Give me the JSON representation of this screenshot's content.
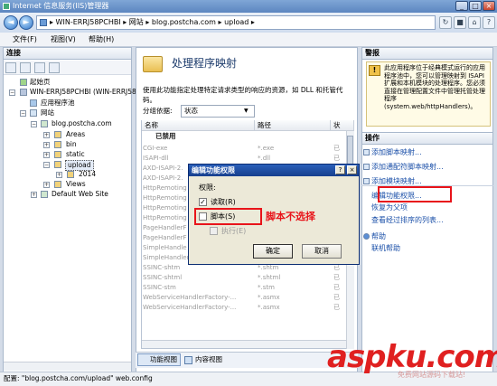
{
  "window": {
    "title": "Internet 信息服务(IIS)管理器"
  },
  "address": {
    "path": "▸ WIN-ERRJ58PCHBI ▸ 网站 ▸ blog.postcha.com ▸ upload ▸"
  },
  "menu": {
    "items": [
      "文件(F)",
      "视图(V)",
      "帮助(H)"
    ]
  },
  "connections": {
    "title": "连接",
    "tree": [
      {
        "label": "起始页",
        "level": 1
      },
      {
        "label": "WIN-ERRJ58PCHBI (WIN-ERRJ58",
        "level": 1
      },
      {
        "label": "应用程序池",
        "level": 2
      },
      {
        "label": "网站",
        "level": 2
      },
      {
        "label": "blog.postcha.com",
        "level": 3
      },
      {
        "label": "Areas",
        "level": 4
      },
      {
        "label": "bin",
        "level": 4
      },
      {
        "label": "static",
        "level": 4
      },
      {
        "label": "upload",
        "level": 4
      },
      {
        "label": "2014",
        "level": 5
      },
      {
        "label": "Views",
        "level": 4
      },
      {
        "label": "Default Web Site",
        "level": 3
      }
    ]
  },
  "main": {
    "title": "处理程序映射",
    "description": "使用此功能指定处理特定请求类型的响应的资源，如 DLL 和托管代码。",
    "group_by_label": "分组依据:",
    "group_by_value": "状态",
    "columns": [
      "名称",
      "路径",
      "状"
    ],
    "group_header": "已禁用",
    "rows": [
      {
        "name": "CGI-exe",
        "path": "*.exe",
        "state": "已"
      },
      {
        "name": "ISAPI-dll",
        "path": "*.dll",
        "state": "已"
      },
      {
        "name": "AXD-ISAPI-2.",
        "path": "*.axd",
        "state": "已"
      },
      {
        "name": "AXD-ISAPI-2.",
        "path": "*.axd",
        "state": "已"
      },
      {
        "name": "HttpRemoting",
        "path": "*.rem",
        "state": "已"
      },
      {
        "name": "HttpRemoting",
        "path": "*.rem",
        "state": "已"
      },
      {
        "name": "HttpRemoting",
        "path": "*.soap",
        "state": "已"
      },
      {
        "name": "HttpRemoting",
        "path": "*.soap",
        "state": "已"
      },
      {
        "name": "PageHandlerF",
        "path": "*.aspx",
        "state": "已"
      },
      {
        "name": "PageHandlerF",
        "path": "*.aspx",
        "state": "已"
      },
      {
        "name": "SimpleHandle",
        "path": "*.ashx",
        "state": "已"
      },
      {
        "name": "SimpleHandlerFactory-ISAP...",
        "path": "*.ashx",
        "state": "已"
      },
      {
        "name": "SSINC-shtm",
        "path": "*.shtm",
        "state": "已"
      },
      {
        "name": "SSINC-shtml",
        "path": "*.shtml",
        "state": "已"
      },
      {
        "name": "SSINC-stm",
        "path": "*.stm",
        "state": "已"
      },
      {
        "name": "WebServiceHandlerFactory-...",
        "path": "*.asmx",
        "state": "已"
      },
      {
        "name": "WebServiceHandlerFactory-...",
        "path": "*.asmx",
        "state": "已"
      }
    ],
    "tabs": [
      "功能视图",
      "内容视图"
    ]
  },
  "actions": {
    "alerts_title": "警报",
    "alert_text": "此应用程序位于经典模式运行的应用程序池中，您可以管理映射到 ISAPI 扩展和本机模块的处理程序。您必须直接在管理配置文件中管理托管处理程序 (system.web/httpHandlers)。",
    "ops_title": "操作",
    "items": [
      "添加脚本映射...",
      "添加通配符脚本映射...",
      "添加模块映射...",
      "编辑功能权限...",
      "恢复为父项",
      "查看经过排序的列表..."
    ],
    "help": [
      "帮助",
      "联机帮助"
    ]
  },
  "dialog": {
    "title": "编辑功能权限",
    "perm_label": "权限:",
    "read_label": "读取(R)",
    "script_label": "脚本(S)",
    "exec_label": "执行(E)",
    "ok_label": "确定",
    "cancel_label": "取消",
    "read_checked": true,
    "script_checked": false,
    "exec_checked": false
  },
  "annotation": {
    "text": "脚本不选择"
  },
  "status": {
    "text": "配置: \"blog.postcha.com/upload\" web.config"
  },
  "watermark": {
    "brand": "aspku.com",
    "sub": "免费网站源码下载站!"
  },
  "colors": {
    "accent_red": "#e8141a",
    "title_blue": "#2b5fb9"
  }
}
